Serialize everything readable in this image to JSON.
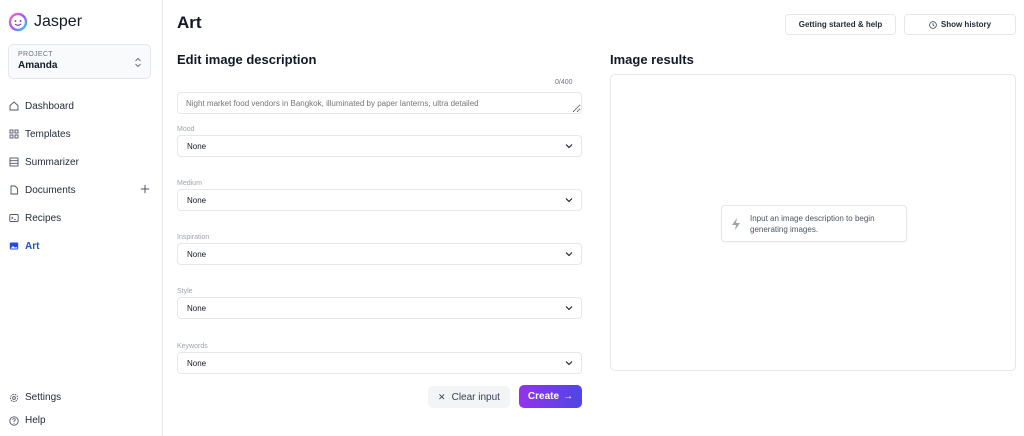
{
  "app": {
    "name": "Jasper"
  },
  "project": {
    "caption": "PROJECT",
    "name": "Amanda"
  },
  "nav": [
    {
      "label": "Dashboard",
      "icon": "home-icon"
    },
    {
      "label": "Templates",
      "icon": "grid-icon"
    },
    {
      "label": "Summarizer",
      "icon": "list-icon"
    },
    {
      "label": "Documents",
      "icon": "document-icon"
    },
    {
      "label": "Recipes",
      "icon": "terminal-icon"
    },
    {
      "label": "Art",
      "icon": "image-icon",
      "active": true
    }
  ],
  "nav_bottom": [
    {
      "label": "Settings",
      "icon": "gear-icon"
    },
    {
      "label": "Help",
      "icon": "help-icon"
    }
  ],
  "page": {
    "title": "Art"
  },
  "header": {
    "help_label": "Getting started & help",
    "history_label": "Show history"
  },
  "editor": {
    "title": "Edit image description",
    "counter": "0/400",
    "description_placeholder": "Night market food vendors in Bangkok, illuminated by paper lanterns, ultra detailed",
    "fields": [
      {
        "label": "Mood",
        "value": "None"
      },
      {
        "label": "Medium",
        "value": "None"
      },
      {
        "label": "Inspiration",
        "value": "None"
      },
      {
        "label": "Style",
        "value": "None"
      },
      {
        "label": "Keywords",
        "value": "None"
      }
    ],
    "clear_label": "Clear input",
    "create_label": "Create"
  },
  "results": {
    "title": "Image results",
    "hint": "Input an image description to begin generating images."
  },
  "colors": {
    "accent": "#1d4ed8",
    "create_start": "#9333ea",
    "create_end": "#4f46e5"
  }
}
